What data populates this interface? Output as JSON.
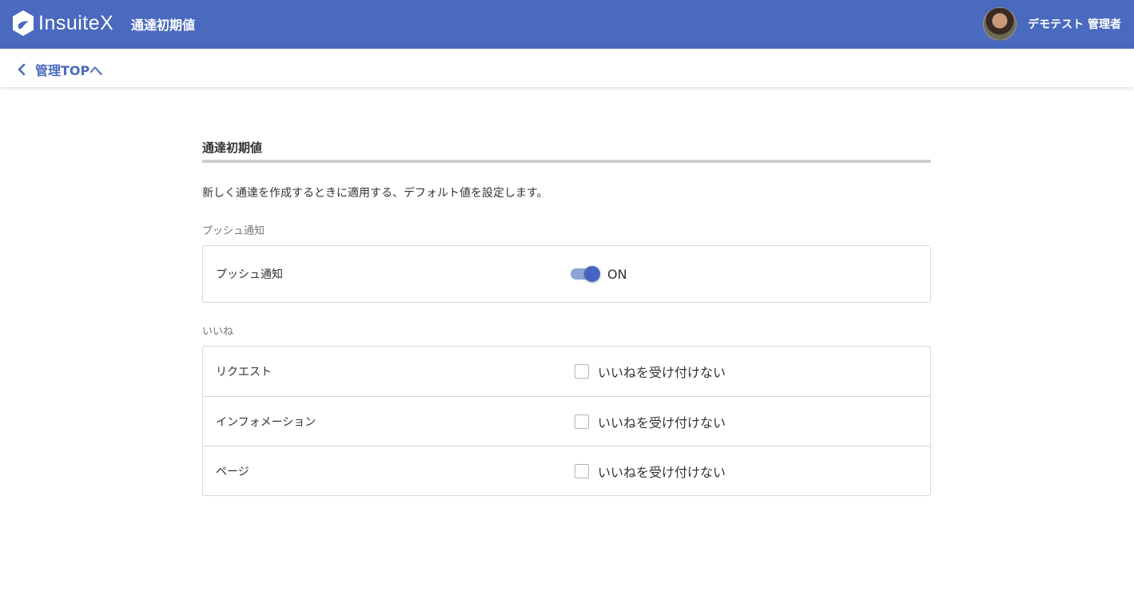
{
  "header": {
    "brand": "InsuiteX",
    "page_title": "通達初期値",
    "user_name": "デモテスト 管理者"
  },
  "nav": {
    "back_label": "管理TOPへ"
  },
  "main": {
    "section_title": "通達初期値",
    "description": "新しく通達を作成するときに適用する、デフォルト値を設定します。",
    "push": {
      "group_label": "プッシュ通知",
      "row_label": "プッシュ通知",
      "toggle_state": "ON",
      "enabled": true
    },
    "likes": {
      "group_label": "いいね",
      "rows": [
        {
          "label": "リクエスト",
          "option": "いいねを受け付けない",
          "checked": false
        },
        {
          "label": "インフォメーション",
          "option": "いいねを受け付けない",
          "checked": false
        },
        {
          "label": "ページ",
          "option": "いいねを受け付けない",
          "checked": false
        }
      ]
    }
  },
  "colors": {
    "appbar": "#4a6abf",
    "accent": "#4565c0",
    "toggle_track": "#8fa4d6"
  },
  "icons": {
    "logo": "insuitex-logo-icon",
    "back": "chevron-left-icon"
  }
}
